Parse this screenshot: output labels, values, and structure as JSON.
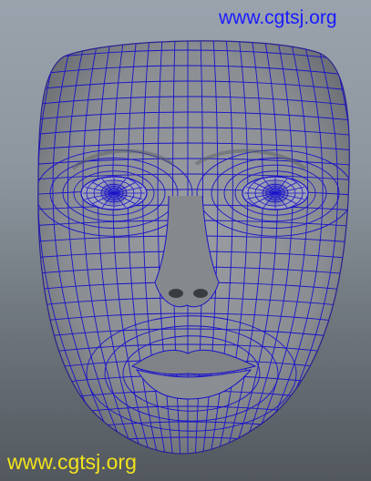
{
  "viewport": {
    "background_top": "#9aa3ad",
    "background_bottom": "#52585e"
  },
  "model": {
    "subject": "face-mesh",
    "surface_color": "#8f9397",
    "wire_color": "#1a12c9",
    "display_mode": "wireframe-on-shaded"
  },
  "watermarks": {
    "top": {
      "text": "www.cgtsj.org",
      "color": "#1a1aff"
    },
    "bottom": {
      "text": "www.cgtsj.org",
      "color": "#f2e21c"
    }
  }
}
